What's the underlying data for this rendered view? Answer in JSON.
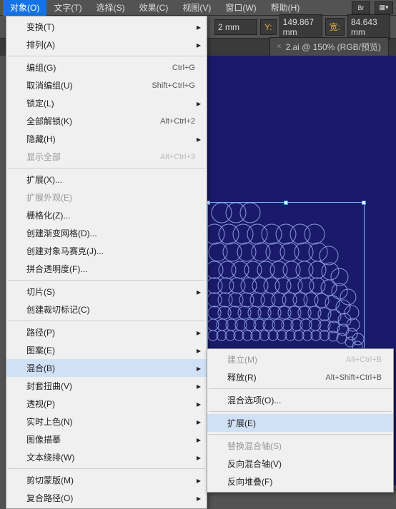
{
  "menubar": {
    "items": [
      "对象(O)",
      "文字(T)",
      "选择(S)",
      "效果(C)",
      "视图(V)",
      "窗口(W)",
      "帮助(H)"
    ],
    "br_label": "Br"
  },
  "controlbar": {
    "unit_suffix": "mm",
    "x_val": "2",
    "y_label": "Y:",
    "y_val": "149.867",
    "w_label": "宽:",
    "w_val": "84.643"
  },
  "tabbar": {
    "tab_title": "2.ai @ 150% (RGB/预览)"
  },
  "menu": {
    "transform": "变换(T)",
    "arrange": "排列(A)",
    "group": "编组(G)",
    "group_sc": "Ctrl+G",
    "ungroup": "取消编组(U)",
    "ungroup_sc": "Shift+Ctrl+G",
    "lock": "锁定(L)",
    "unlockall": "全部解锁(K)",
    "unlockall_sc": "Alt+Ctrl+2",
    "hide": "隐藏(H)",
    "showall": "显示全部",
    "showall_sc": "Alt+Ctrl+3",
    "expand": "扩展(X)...",
    "expandapp": "扩展外观(E)",
    "rasterize": "栅格化(Z)...",
    "gradientmesh": "创建渐变网格(D)...",
    "mosaic": "创建对象马赛克(J)...",
    "flatten": "拼合透明度(F)...",
    "slice": "切片(S)",
    "cropmarks": "创建裁切标记(C)",
    "path": "路径(P)",
    "pattern": "图案(E)",
    "blend": "混合(B)",
    "envelope": "封套扭曲(V)",
    "perspective": "透视(P)",
    "livepaint": "实时上色(N)",
    "imagetrace": "图像描摹",
    "textwrap": "文本绕排(W)",
    "clipmask": "剪切蒙版(M)",
    "compoundpath": "复合路径(O)"
  },
  "submenu": {
    "make": "建立(M)",
    "make_sc": "Alt+Ctrl+B",
    "release": "释放(R)",
    "release_sc": "Alt+Shift+Ctrl+B",
    "options": "混合选项(O)...",
    "expand": "扩展(E)",
    "replacespine": "替换混合轴(S)",
    "reversespine": "反向混合轴(V)",
    "reversefb": "反向堆叠(F)"
  }
}
